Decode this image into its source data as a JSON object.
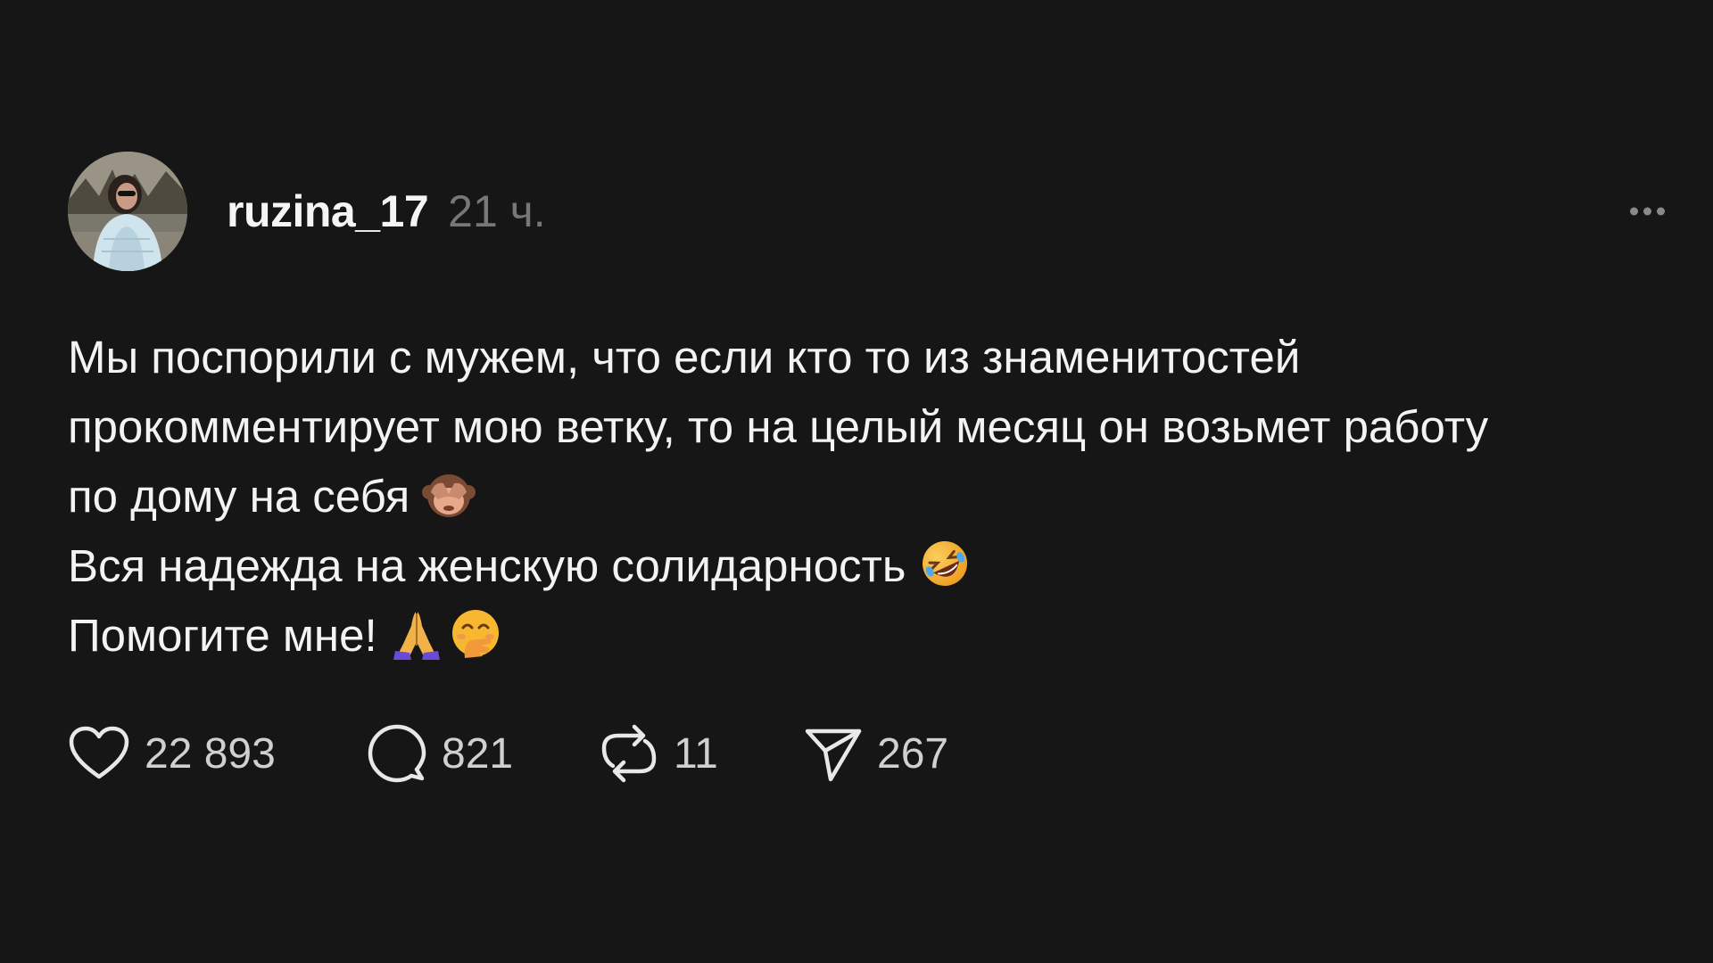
{
  "post": {
    "author": {
      "username": "ruzina_17",
      "time": "21 ч."
    },
    "text_lines": [
      "Мы поспорили с мужем, что если кто то из знаменитостей",
      "прокомментирует мою ветку, то на целый месяц он возьмет работу",
      "по дому на себя",
      "Вся надежда на женскую солидарность",
      "Помогите мне!"
    ],
    "emojis": {
      "line3": "see-no-evil-monkey-icon",
      "line4": "rolling-laughing-icon",
      "line5": [
        "folded-hands-icon",
        "hand-over-mouth-icon"
      ]
    },
    "stats": {
      "likes": "22 893",
      "replies": "821",
      "reposts": "11",
      "shares": "267"
    }
  },
  "colors": {
    "background": "#161616",
    "text": "#f3f3f3",
    "muted": "#777777",
    "count": "#d0d0d0"
  }
}
